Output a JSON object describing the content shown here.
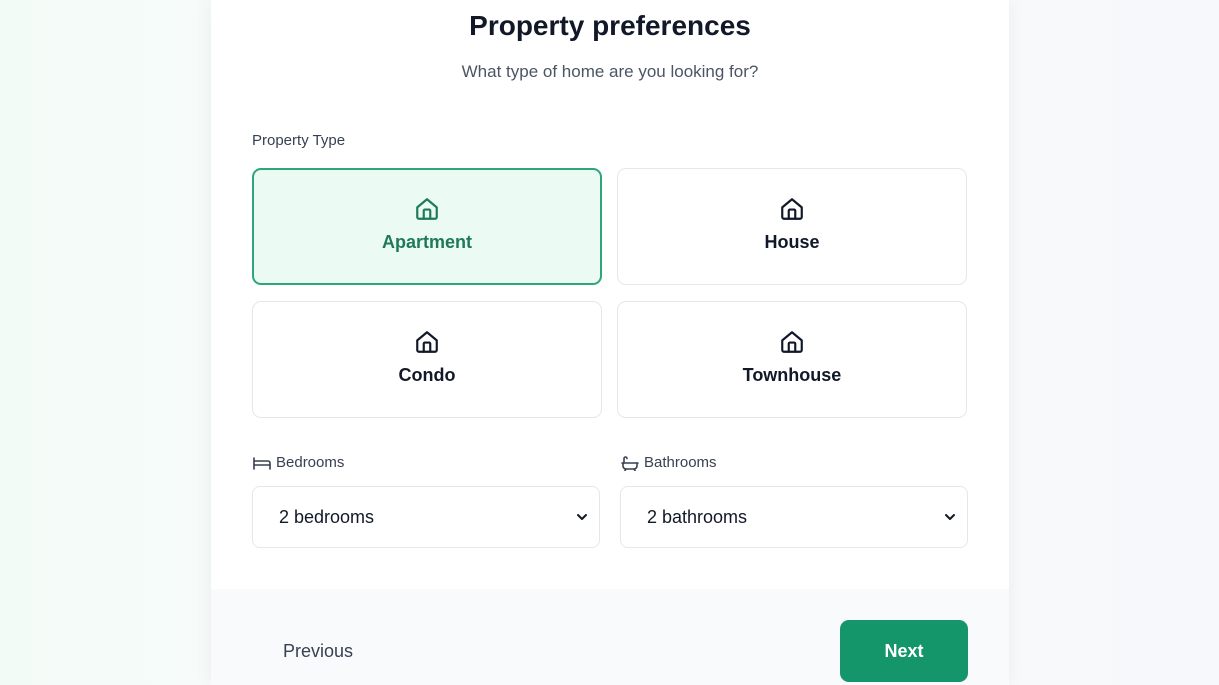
{
  "header": {
    "title": "Property preferences",
    "subtitle": "What type of home are you looking for?"
  },
  "property_type": {
    "label": "Property Type",
    "options": [
      {
        "label": "Apartment",
        "icon": "home-icon",
        "selected": true
      },
      {
        "label": "House",
        "icon": "home-icon",
        "selected": false
      },
      {
        "label": "Condo",
        "icon": "home-icon",
        "selected": false
      },
      {
        "label": "Townhouse",
        "icon": "home-icon",
        "selected": false
      }
    ]
  },
  "bedrooms": {
    "label": "Bedrooms",
    "icon": "bed-icon",
    "value": "2 bedrooms"
  },
  "bathrooms": {
    "label": "Bathrooms",
    "icon": "bath-icon",
    "value": "2 bathrooms"
  },
  "footer": {
    "previous_label": "Previous",
    "next_label": "Next"
  },
  "colors": {
    "accent": "#15956a",
    "selected_bg": "#ebfaf2",
    "selected_border": "#2ea57b",
    "selected_text": "#1f7a58"
  }
}
